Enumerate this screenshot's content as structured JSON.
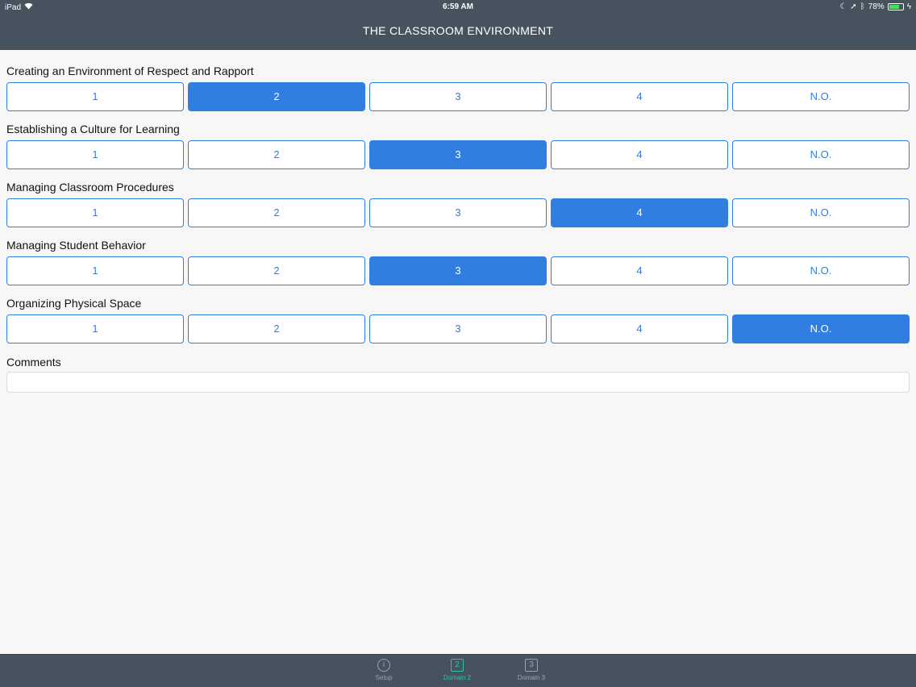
{
  "status_bar": {
    "device": "iPad",
    "time": "6:59 AM",
    "battery": "78%",
    "battery_level": 0.78
  },
  "header": {
    "title": "THE CLASSROOM ENVIRONMENT"
  },
  "rating_options": [
    "1",
    "2",
    "3",
    "4",
    "N.O."
  ],
  "sections": [
    {
      "label": "Creating an Environment of Respect and Rapport",
      "selected": "2"
    },
    {
      "label": "Establishing a Culture for Learning",
      "selected": "3"
    },
    {
      "label": "Managing Classroom Procedures",
      "selected": "4"
    },
    {
      "label": "Managing Student Behavior",
      "selected": "3"
    },
    {
      "label": "Organizing Physical Space",
      "selected": "N.O."
    }
  ],
  "comments": {
    "label": "Comments",
    "value": "",
    "placeholder": ""
  },
  "tabbar": {
    "tabs": [
      {
        "label": "Setup",
        "icon": "info-icon",
        "glyph": "i",
        "active": false
      },
      {
        "label": "Domain 2",
        "icon": "number-2-icon",
        "glyph": "2",
        "active": true
      },
      {
        "label": "Domain 3",
        "icon": "number-3-icon",
        "glyph": "3",
        "active": false
      }
    ]
  },
  "colors": {
    "header_bg": "#46535f",
    "accent": "#2f7ee0",
    "active_tab": "#2bc3a1"
  }
}
